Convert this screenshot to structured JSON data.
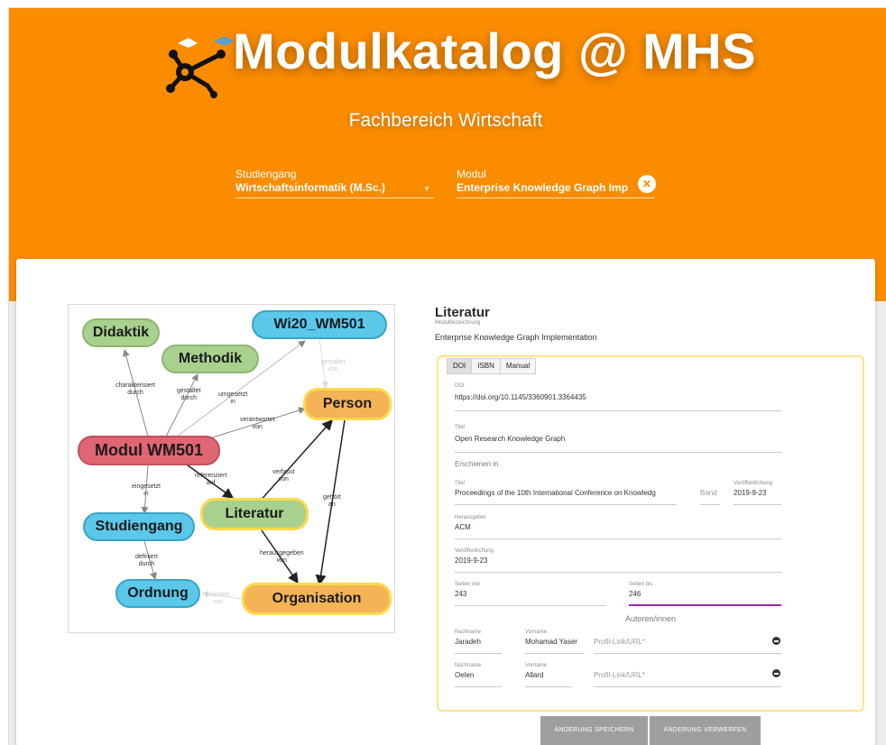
{
  "header": {
    "title": "Modulkatalog @ MHS",
    "subtitle": "Fachbereich Wirtschaft"
  },
  "filters": {
    "study_label": "Studiengang",
    "study_value": "Wirtschaftsinformatik (M.Sc.)",
    "module_label": "Modul",
    "module_value": "Enterprise Knowledge Graph Implementation"
  },
  "graph": {
    "nodes": {
      "didaktik": "Didaktik",
      "methodik": "Methodik",
      "wi20": "Wi20_WM501",
      "person": "Person",
      "modul": "Modul WM501",
      "literatur": "Literatur",
      "studiengang": "Studiengang",
      "ordnung": "Ordnung",
      "organisation": "Organisation"
    },
    "edges": {
      "charakterisiert": "charakterisiert\ndurch",
      "gestaltet": "gestaltet\ndurch",
      "umgesetzt": "umgesetzt\nin",
      "verantwortet": "verantwortet\nvon",
      "gestaltet_von": "gestaltet\nvon",
      "verfasst": "verfasst\nvon",
      "referenziert": "referenziert\nauf",
      "eingesetzt": "eingesetzt\nin",
      "gehoert": "gehört\nan",
      "herausgegeben": "herausgegeben\nvon",
      "definiert": "definiert\ndurch",
      "erlassen": "erlassen\nvon"
    }
  },
  "literature": {
    "title": "Literatur",
    "sub_label": "Modulbezeichnung",
    "sub_value": "Enterprise Knowledge Graph Implementation",
    "tabs": [
      "DOI",
      "ISBN",
      "Manual"
    ],
    "doi_label": "DOI",
    "doi_value": "https://doi.org/10.1145/3360901.3364435",
    "titel_label": "Titel",
    "titel_value": "Open Research Knowledge Graph",
    "published_in": "Erschienen in",
    "venue_title_label": "Titel",
    "venue_title_value": "Proceedings of the 10th International Conference on Knowledg",
    "band_placeholder": "Band",
    "venue_date_label": "Veröffentlichung",
    "venue_date_value": "2019-9-23",
    "publisher_label": "Herausgeber",
    "publisher_value": "ACM",
    "pub_label": "Veröffentlichung",
    "pub_value": "2019-9-23",
    "pages_from_label": "Seiten von",
    "pages_from_value": "243",
    "pages_to_label": "Seiten bis",
    "pages_to_value": "246",
    "authors_heading": "Autoren/innen",
    "authors": [
      {
        "lastname_label": "Nachname",
        "lastname": "Jaradeh",
        "firstname_label": "Vorname",
        "firstname": "Mohamad Yaser",
        "profile_placeholder": "Profil-Link/URL*"
      },
      {
        "lastname_label": "Nachname",
        "lastname": "Oelen",
        "firstname_label": "Vorname",
        "firstname": "Allard",
        "profile_placeholder": "Profil-Link/URL*"
      }
    ]
  },
  "actions": {
    "save": "ÄNDERUNG SPEICHERN",
    "discard": "ÄNDERUNG VERWERFEN"
  },
  "colors": {
    "accent": "#fb8c00",
    "focus": "#9c27b0"
  }
}
